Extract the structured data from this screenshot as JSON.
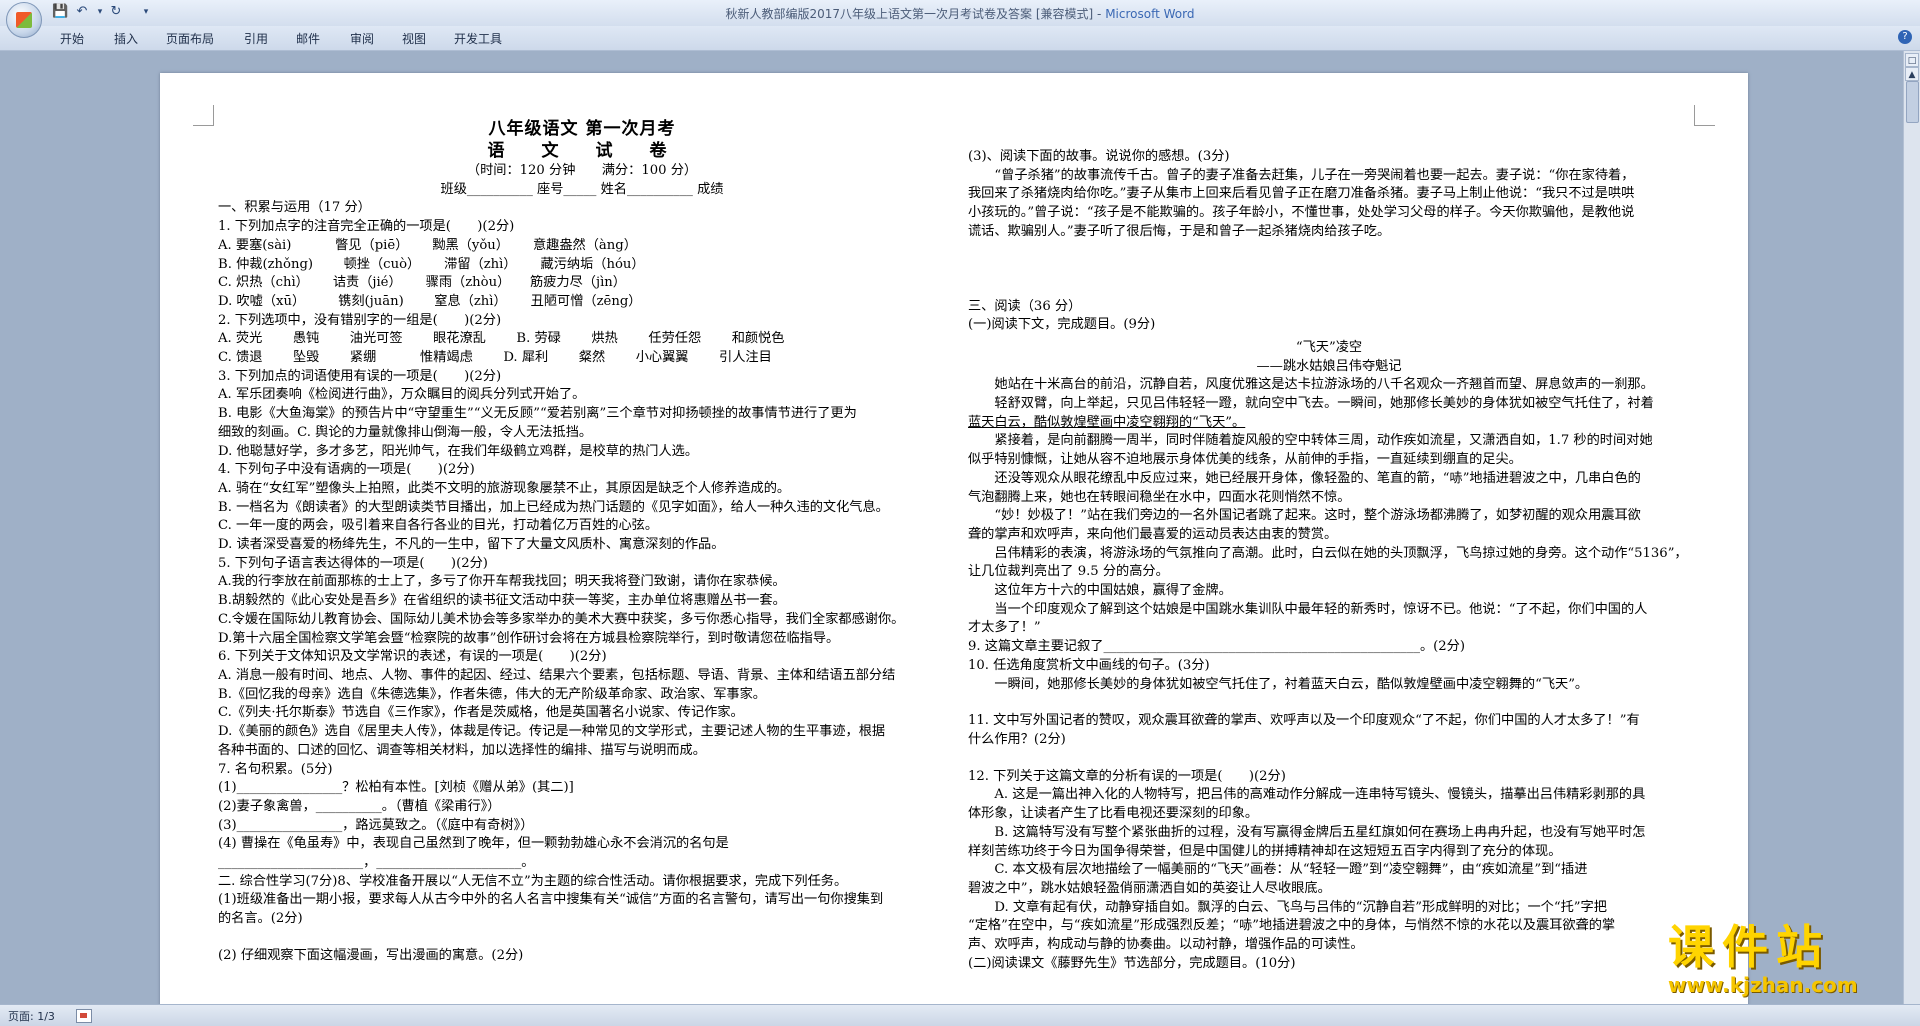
{
  "window": {
    "title": "秋新人教部编版2017八年级上语文第一次月考试卷及答案 [兼容模式] - ",
    "app_name": "Microsoft Word"
  },
  "ribbon": {
    "tabs": [
      "开始",
      "插入",
      "页面布局",
      "引用",
      "邮件",
      "审阅",
      "视图",
      "开发工具"
    ]
  },
  "status": {
    "page": "页面: 1/3"
  },
  "watermark": {
    "title": "课件站",
    "url": "www.kjzhan.com"
  },
  "left_column": [
    "八年级语文 第一次月考",
    "语　文　试　卷",
    "（时间：120 分钟　　满分：100 分）",
    "班级__________ 座号_____ 姓名__________ 成绩",
    "一、积累与运用（17 分）",
    "1. 下列加点字的注音完全正确的一项是(　　)(2分)",
    "A. 要塞(sài)　　　 瞥见（piē）　　 黝黑（yǒu）　　 意趣盎然（àng）",
    "B. 仲裁(zhǒng)　　 顿挫（cuò）　　 滞留（zhì）　　 藏污纳垢（hóu）",
    "C. 炽热（chì）　　 诘责（jié）　　 骤雨（zhòu）　　筋疲力尽（jìn）",
    "D. 吹嘘（xū）　　　镌刻(juān)　　 窒息（zhì）　　 丑陋可憎（zēng）",
    "2. 下列选项中，没有错别字的一组是(　　)(2分)",
    "A. 荧光　　 愚钝　　 油光可签　　 眼花潦乱　　 B. 劳碌　　 烘热　　 任劳任怨　　 和颜悦色",
    "C. 馈退　　 坠毁　　 紧绷　　　 惟精竭虑　　 D. 犀利　　 粲然　　 小心翼翼　　 引人注目",
    "3. 下列加点的词语使用有误的一项是(　　)(2分)",
    "A. 军乐团奏响《检阅进行曲》，万众瞩目的阅兵分列式开始了。",
    "B. 电影《大鱼海棠》的预告片中“守望重生”“义无反顾”“爱若别离”三个章节对抑扬顿挫的故事情节进行了更为",
    "细致的刻画。C. 舆论的力量就像排山倒海一般，令人无法抵挡。",
    "D. 他聪慧好学，多才多艺，阳光帅气，在我们年级鹤立鸡群，是校草的热门人选。",
    "4. 下列句子中没有语病的一项是(　　)(2分)",
    "A. 骑在“女红军”塑像头上拍照，此类不文明的旅游现象屡禁不止，其原因是缺乏个人修养造成的。",
    "B. 一档名为《朗读者》的大型朗读类节目播出，加上已经成为热门话题的《见字如面》，给人一种久违的文化气息。",
    "C. 一年一度的两会，吸引着来自各行各业的目光，打动着亿万百姓的心弦。",
    "D. 读者深受喜爱的杨绛先生，不凡的一生中，留下了大量文风质朴、寓意深刻的作品。",
    "5. 下列句子语言表达得体的一项是(　　)(2分)",
    "A.我的行李放在前面那栋的士上了，多亏了你开车帮我找回；明天我将登门致谢，请你在家恭候。",
    "B.胡毅然的《此心安处是吾乡》在省组织的读书征文活动中获一等奖，主办单位将惠赠丛书一套。",
    "C.令媛在国际幼儿教育协会、国际幼儿美术协会等多家举办的美术大赛中获奖，多亏你悉心指导，我们全家都感谢你。",
    "D.第十六届全国检察文学笔会暨“检察院的故事”创作研讨会将在方城县检察院举行，到时敬请您莅临指导。",
    "6. 下列关于文体知识及文学常识的表述，有误的一项是(　　)(2分)",
    "A. 消息一般有时间、地点、人物、事件的起因、经过、结果六个要素，包括标题、导语、背景、主体和结语五部分结",
    "B.《回忆我的母亲》选自《朱德选集》，作者朱德，伟大的无产阶级革命家、政治家、军事家。",
    "C.《列夫·托尔斯泰》节选自《三作家》，作者是茨威格，他是英国著名小说家、传记作家。",
    "D.《美丽的颜色》选自《居里夫人传》，体裁是传记。传记是一种常见的文学形式，主要记述人物的生平事迹，根据",
    "各种书面的、口述的回忆、调查等相关材料，加以选择性的编排、描写与说明而成。",
    "7. 名句积累。(5分)",
    "(1)________________？松柏有本性。[刘桢《赠从弟》(其二)]",
    "(2)妻子象禽兽，__________。（曹植《梁甫行》）",
    "(3)________________，路远莫致之。（《庭中有奇树》）",
    "(4) 曹操在《龟虽寿》中，表现自己虽然到了晚年，但一颗勃勃雄心永不会消沉的名句是",
    "______________________，______________________。",
    "二. 综合性学习(7分)8、学校准备开展以“人无信不立”为主题的综合性活动。请你根据要求，完成下列任务。",
    "(1)班级准备出一期小报，要求每人从古今中外的名人名言中搜集有关“诚信”方面的名言警句，请写出一句你搜集到",
    "的名言。(2分)",
    "(2) 仔细观察下面这幅漫画，写出漫画的寓意。(2分)"
  ],
  "right_column": [
    "(3)、阅读下面的故事。说说你的感想。(3分)",
    "“曾子杀猪”的故事流传千古。曾子的妻子准备去赶集，儿子在一旁哭闹着也要一起去。妻子说：“你在家待着，",
    "我回来了杀猪烧肉给你吃。”妻子从集市上回来后看见曾子正在磨刀准备杀猪。妻子马上制止他说：“我只不过是哄哄",
    "小孩玩的。”曾子说：“孩子是不能欺骗的。孩子年龄小，不懂世事，处处学习父母的样子。今天你欺骗他，是教他说",
    "谎话、欺骗别人。”妻子听了很后悔，于是和曾子一起杀猪烧肉给孩子吃。",
    "三、阅读（36 分）",
    "(一)阅读下文，完成题目。(9分)",
    "“飞天”凌空",
    "——跳水姑娘吕伟夺魁记",
    "她站在十米高台的前沿，沉静自若，风度优雅这是达卡拉游泳场的八千名观众一齐翘首而望、屏息敛声的一刹那。",
    "轻舒双臂，向上举起，只见吕伟轻轻一蹬，就向空中飞去。一瞬间，她那修长美妙的身体犹如被空气托住了，衬着",
    "蓝天白云，酷似敦煌壁画中凌空翱翔的“飞天”。",
    "紧接着，是向前翻腾一周半，同时伴随着旋风般的空中转体三周，动作疾如流星，又潇洒自如，1.7 秒的时间对她",
    "似乎特别慷慨，让她从容不迫地展示身体优美的线条，从前伸的手指，一直延续到绷直的足尖。",
    "还没等观众从眼花缭乱中反应过来，她已经展开身体，像轻盈的、笔直的箭，“哧”地插进碧波之中，几串白色的",
    "气泡翻腾上来，她也在转眼间稳坐在水中，四面水花则悄然不惊。",
    "“妙！妙极了！”站在我们旁边的一名外国记者跳了起来。这时，整个游泳场都沸腾了，如梦初醒的观众用震耳欲",
    "聋的掌声和欢呼声，来向他们最喜爱的运动员表达由衷的赞赏。",
    "吕伟精彩的表演，将游泳场的气氛推向了高潮。此时，白云似在她的头顶飘浮，飞鸟掠过她的身旁。这个动作“5136”，",
    "让几位裁判亮出了 9.5 分的高分。",
    "这位年方十六的中国姑娘，赢得了金牌。",
    "当一个印度观众了解到这个姑娘是中国跳水集训队中最年轻的新秀时，惊讶不已。他说：“了不起，你们中国的人",
    "才太多了！”",
    "9. 这篇文章主要记叙了________________________________________________。(2分)",
    "10. 任选角度赏析文中画线的句子。(3分)",
    "一瞬间，她那修长美妙的身体犹如被空气托住了，衬着蓝天白云，酷似敦煌壁画中凌空翱舞的“飞天”。",
    "11. 文中写外国记者的赞叹，观众震耳欲聋的掌声、欢呼声以及一个印度观众“了不起，你们中国的人才太多了！”有",
    "什么作用？(2分)",
    "12. 下列关于这篇文章的分析有误的一项是(　　)(2分)",
    "A. 这是一篇出神入化的人物特写，把吕伟的高难动作分解成一连串特写镜头、慢镜头，描摹出吕伟精彩剥那的具",
    "体形象，让读者产生了比看电视还要深刻的印象。",
    "B. 这篇特写没有写整个紧张曲折的过程，没有写赢得金牌后五星红旗如何在赛场上冉冉升起，也没有写她平时怎",
    "样刻苦练功终于今日为国争得荣誉，但是中国健儿的拼搏精神却在这短短五百字内得到了充分的体现。",
    "C. 本文极有层次地描绘了一幅美丽的“飞天”画卷：从“轻轻一蹬”到“凌空翱舞”，由“疾如流星”到“插进",
    "碧波之中”，跳水姑娘轻盈俏丽潇洒自如的英姿让人尽收眼底。",
    "D. 文章有起有伏，动静穿插自如。飘浮的白云、飞鸟与吕伟的“沉静自若”形成鲜明的对比；一个“托”字把",
    "“定格”在空中，与“疾如流星”形成强烈反差；“哧”地插进碧波之中的身体，与悄然不惊的水花以及震耳欲聋的掌",
    "声、欢呼声，构成动与静的协奏曲。以动衬静，增强作品的可读性。",
    "(二)阅读课文《藤野先生》节选部分，完成题目。(10分)"
  ]
}
